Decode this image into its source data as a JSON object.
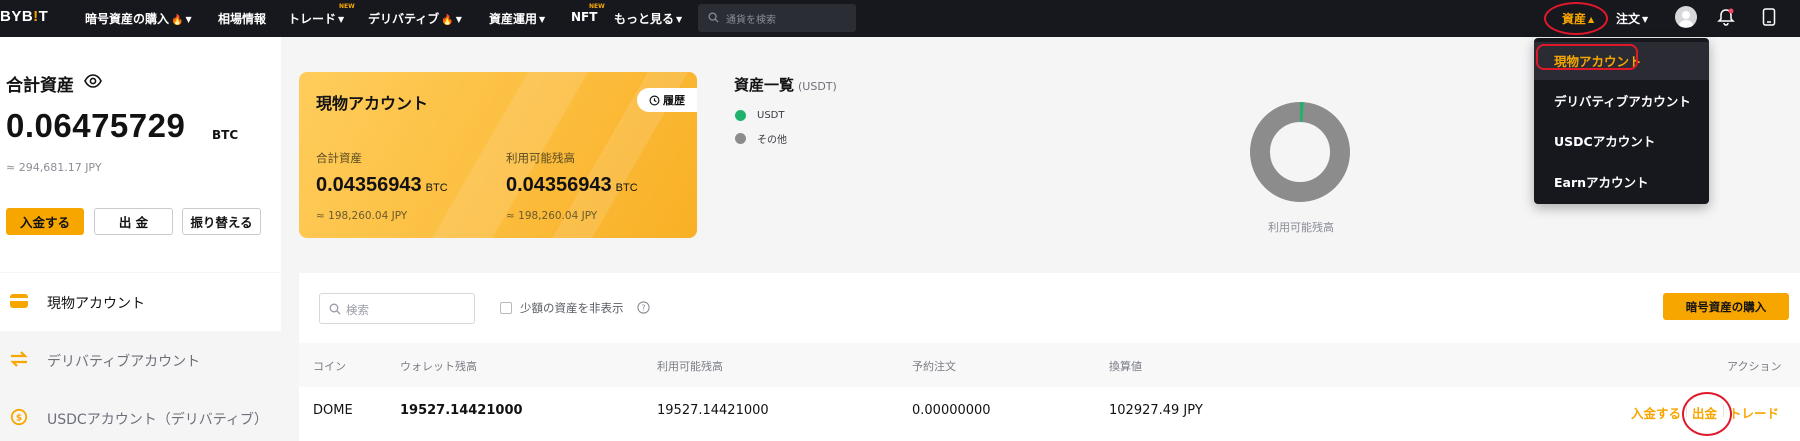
{
  "nav": {
    "logo_main": "BYB",
    "logo_bang": "!",
    "logo_end": "T",
    "items": [
      {
        "label": "暗号資産の購入",
        "fire": true,
        "caret": true
      },
      {
        "label": "相場情報",
        "fire": false,
        "caret": false
      },
      {
        "label": "トレード",
        "fire": false,
        "caret": true,
        "new": true
      },
      {
        "label": "デリバティブ",
        "fire": true,
        "caret": true
      },
      {
        "label": "資産運用",
        "fire": false,
        "caret": true
      },
      {
        "label": "NFT",
        "fire": false,
        "caret": false,
        "new": true
      },
      {
        "label": "もっと見る",
        "fire": false,
        "caret": true
      }
    ],
    "new_badge": "NEW",
    "search_placeholder": "通貨を検索",
    "assets_label": "資産",
    "orders_label": "注文"
  },
  "dropdown": {
    "options": [
      "現物アカウント",
      "デリバティブアカウント",
      "USDCアカウント",
      "Earnアカウント"
    ]
  },
  "summary": {
    "title": "合計資産",
    "total_btc": "0.06475729",
    "unit": "BTC",
    "total_jpy": "≈ 294,681.17 JPY",
    "deposit": "入金する",
    "withdraw": "出 金",
    "transfer": "振り替える"
  },
  "leftnav": [
    "現物アカウント",
    "デリバティブアカウント",
    "USDCアカウント（デリバティブ）"
  ],
  "spot_card": {
    "title": "現物アカウント",
    "history": "履歴",
    "total_label": "合計資産",
    "total_value": "0.04356943",
    "total_unit": "BTC",
    "total_jpy": "≈ 198,260.04 JPY",
    "avail_label": "利用可能残高",
    "avail_value": "0.04356943",
    "avail_unit": "BTC",
    "avail_jpy": "≈ 198,260.04 JPY"
  },
  "overview": {
    "title": "資産一覧",
    "unit": "(USDT)",
    "legend": [
      {
        "label": "USDT",
        "color": "#20b26c"
      },
      {
        "label": "その他",
        "color": "#8c8c8c"
      }
    ],
    "donut_label": "利用可能残高"
  },
  "table": {
    "search_placeholder": "検索",
    "hide_small": "少額の資産を非表示",
    "buy_button": "暗号資産の購入",
    "headers": [
      "コイン",
      "ウォレット残高",
      "利用可能残高",
      "予約注文",
      "換算値",
      "アクション"
    ],
    "row": {
      "coin": "DOME",
      "wallet": "19527.14421000",
      "available": "19527.14421000",
      "reserved": "0.00000000",
      "converted": "102927.49 JPY"
    },
    "actions": [
      "入金する",
      "出金",
      "トレード"
    ]
  },
  "colors": {
    "accent": "#f7a600",
    "nav_bg": "#17181e",
    "annotation": "#e0182b"
  }
}
